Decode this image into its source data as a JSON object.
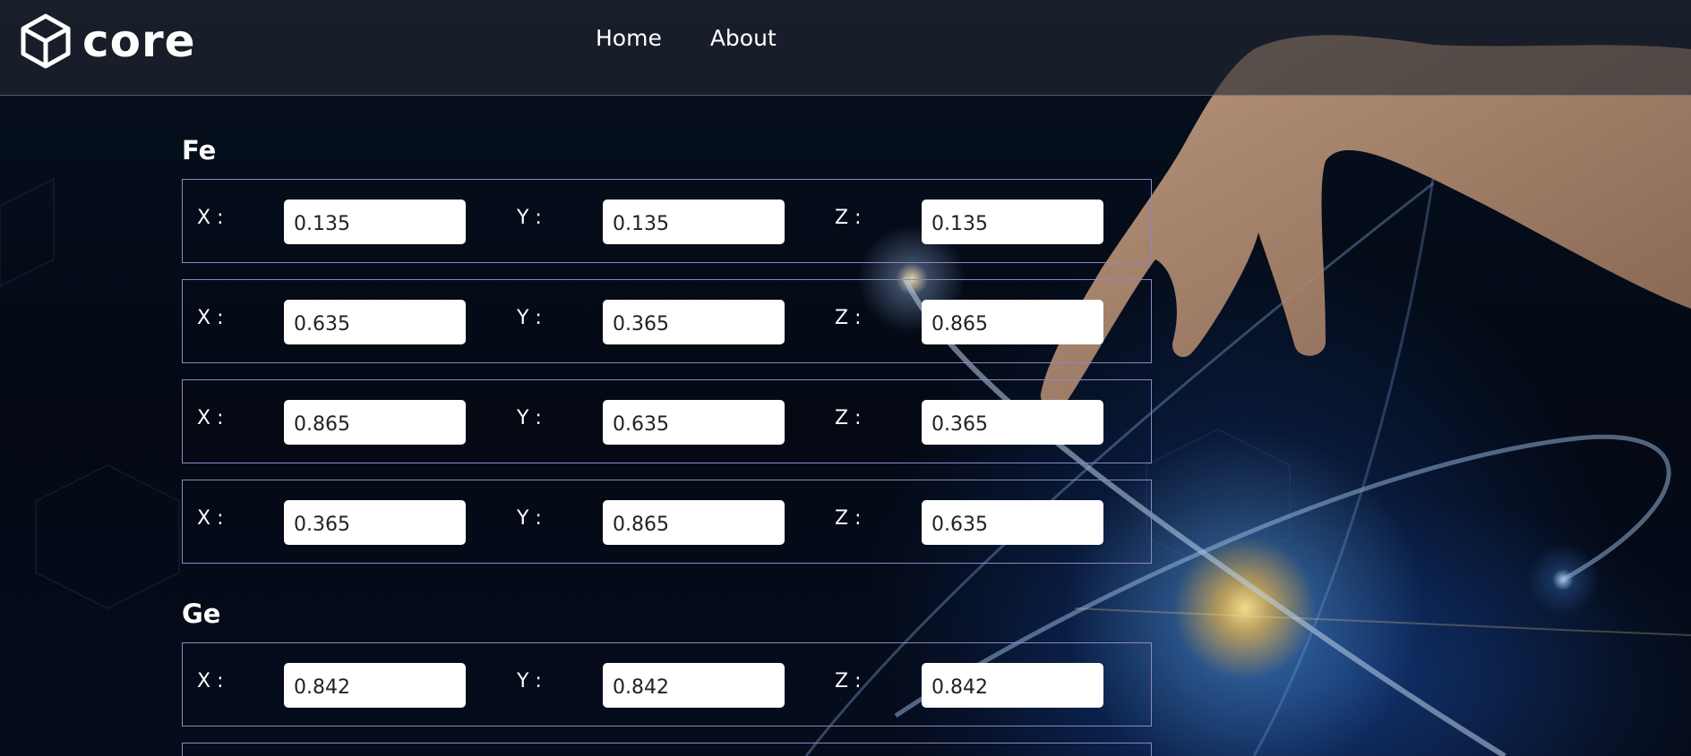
{
  "brand": {
    "logo_text": "core",
    "logo_icon": "cube-icon"
  },
  "nav": {
    "items": [
      {
        "label": "Home"
      },
      {
        "label": "About"
      }
    ]
  },
  "colors": {
    "row_border": "#8f86c4",
    "header_bg": "#262a31",
    "text": "#ffffff",
    "input_bg": "#ffffff"
  },
  "groups": [
    {
      "title": "Fe",
      "rows": [
        {
          "x_label": "X :",
          "x": "0.135",
          "y_label": "Y :",
          "y": "0.135",
          "z_label": "Z :",
          "z": "0.135"
        },
        {
          "x_label": "X :",
          "x": "0.635",
          "y_label": "Y :",
          "y": "0.365",
          "z_label": "Z :",
          "z": "0.865"
        },
        {
          "x_label": "X :",
          "x": "0.865",
          "y_label": "Y :",
          "y": "0.635",
          "z_label": "Z :",
          "z": "0.365"
        },
        {
          "x_label": "X :",
          "x": "0.365",
          "y_label": "Y :",
          "y": "0.865",
          "z_label": "Z :",
          "z": "0.635"
        }
      ]
    },
    {
      "title": "Ge",
      "rows": [
        {
          "x_label": "X :",
          "x": "0.842",
          "y_label": "Y :",
          "y": "0.842",
          "z_label": "Z :",
          "z": "0.842"
        }
      ]
    }
  ]
}
